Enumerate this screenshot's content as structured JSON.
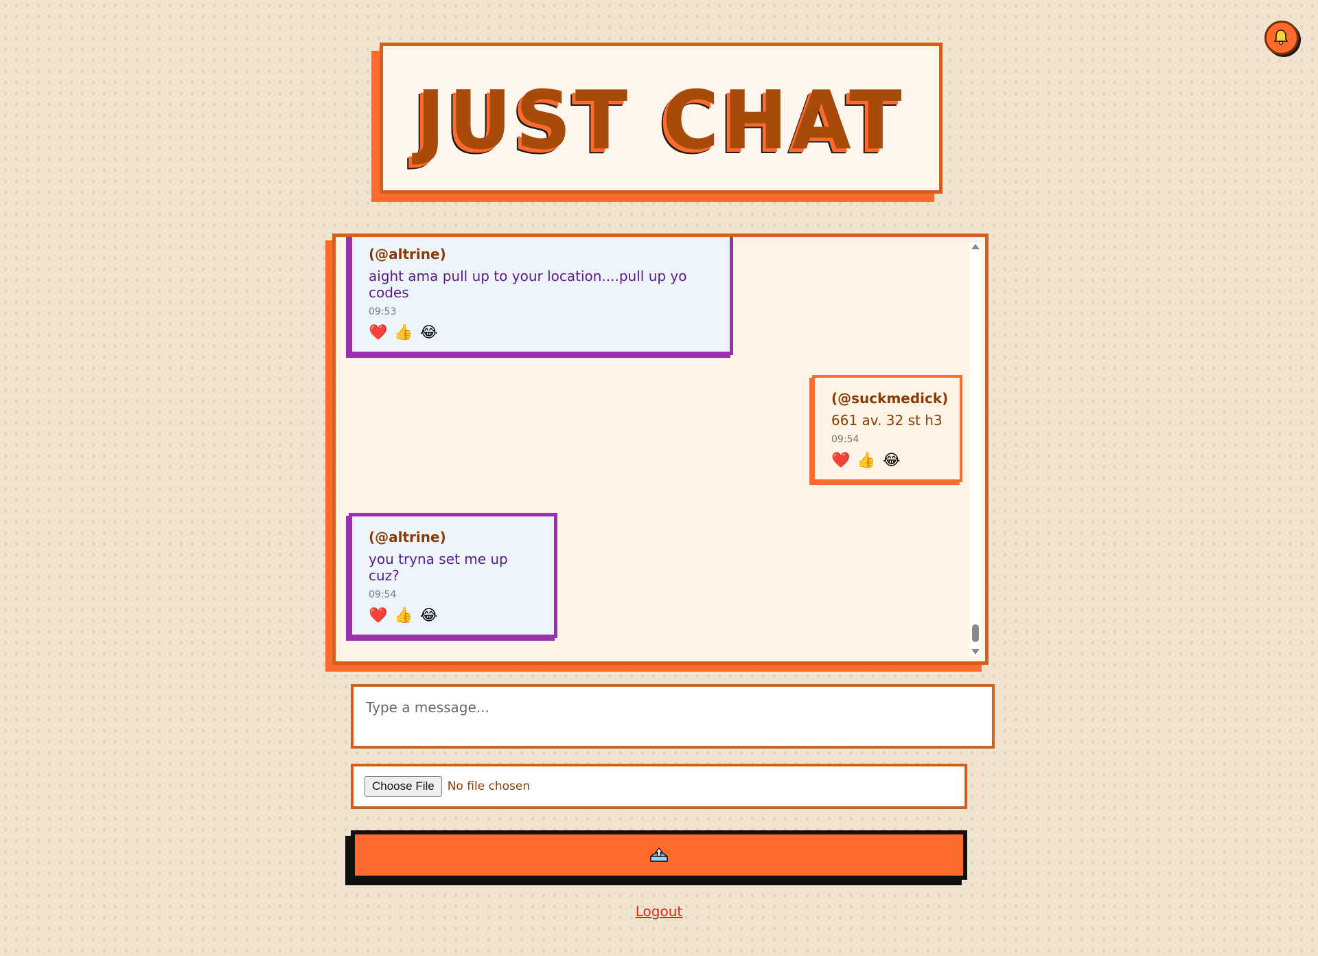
{
  "app": {
    "title": "JUST CHAT"
  },
  "notifications": {
    "icon": "bell-icon"
  },
  "messages": [
    {
      "user": "(@altrine)",
      "text": "aight ama pull up to your location....pull up yo codes",
      "time": "09:53",
      "side": "other",
      "reactions": [
        "❤️",
        "👍",
        "😂"
      ]
    },
    {
      "user": "(@suckmedick)",
      "text": "661 av. 32 st h3",
      "time": "09:54",
      "side": "mine",
      "reactions": [
        "❤️",
        "👍",
        "😂"
      ]
    },
    {
      "user": "(@altrine)",
      "text": "you tryna set me up cuz?",
      "time": "09:54",
      "side": "other",
      "reactions": [
        "❤️",
        "👍",
        "😂"
      ]
    }
  ],
  "composer": {
    "placeholder": "Type a message...",
    "file_button": "Choose File",
    "file_status": "No file chosen",
    "send_icon": "send-tray-icon"
  },
  "footer": {
    "logout": "Logout"
  },
  "colors": {
    "background": "#f0e4d0",
    "accent": "#ff6b2c",
    "accent_dark": "#d2601a",
    "title_text": "#a84a0a",
    "other_border": "#9b2fb0",
    "other_bg": "#eef4fb",
    "logout": "#e0251b"
  }
}
